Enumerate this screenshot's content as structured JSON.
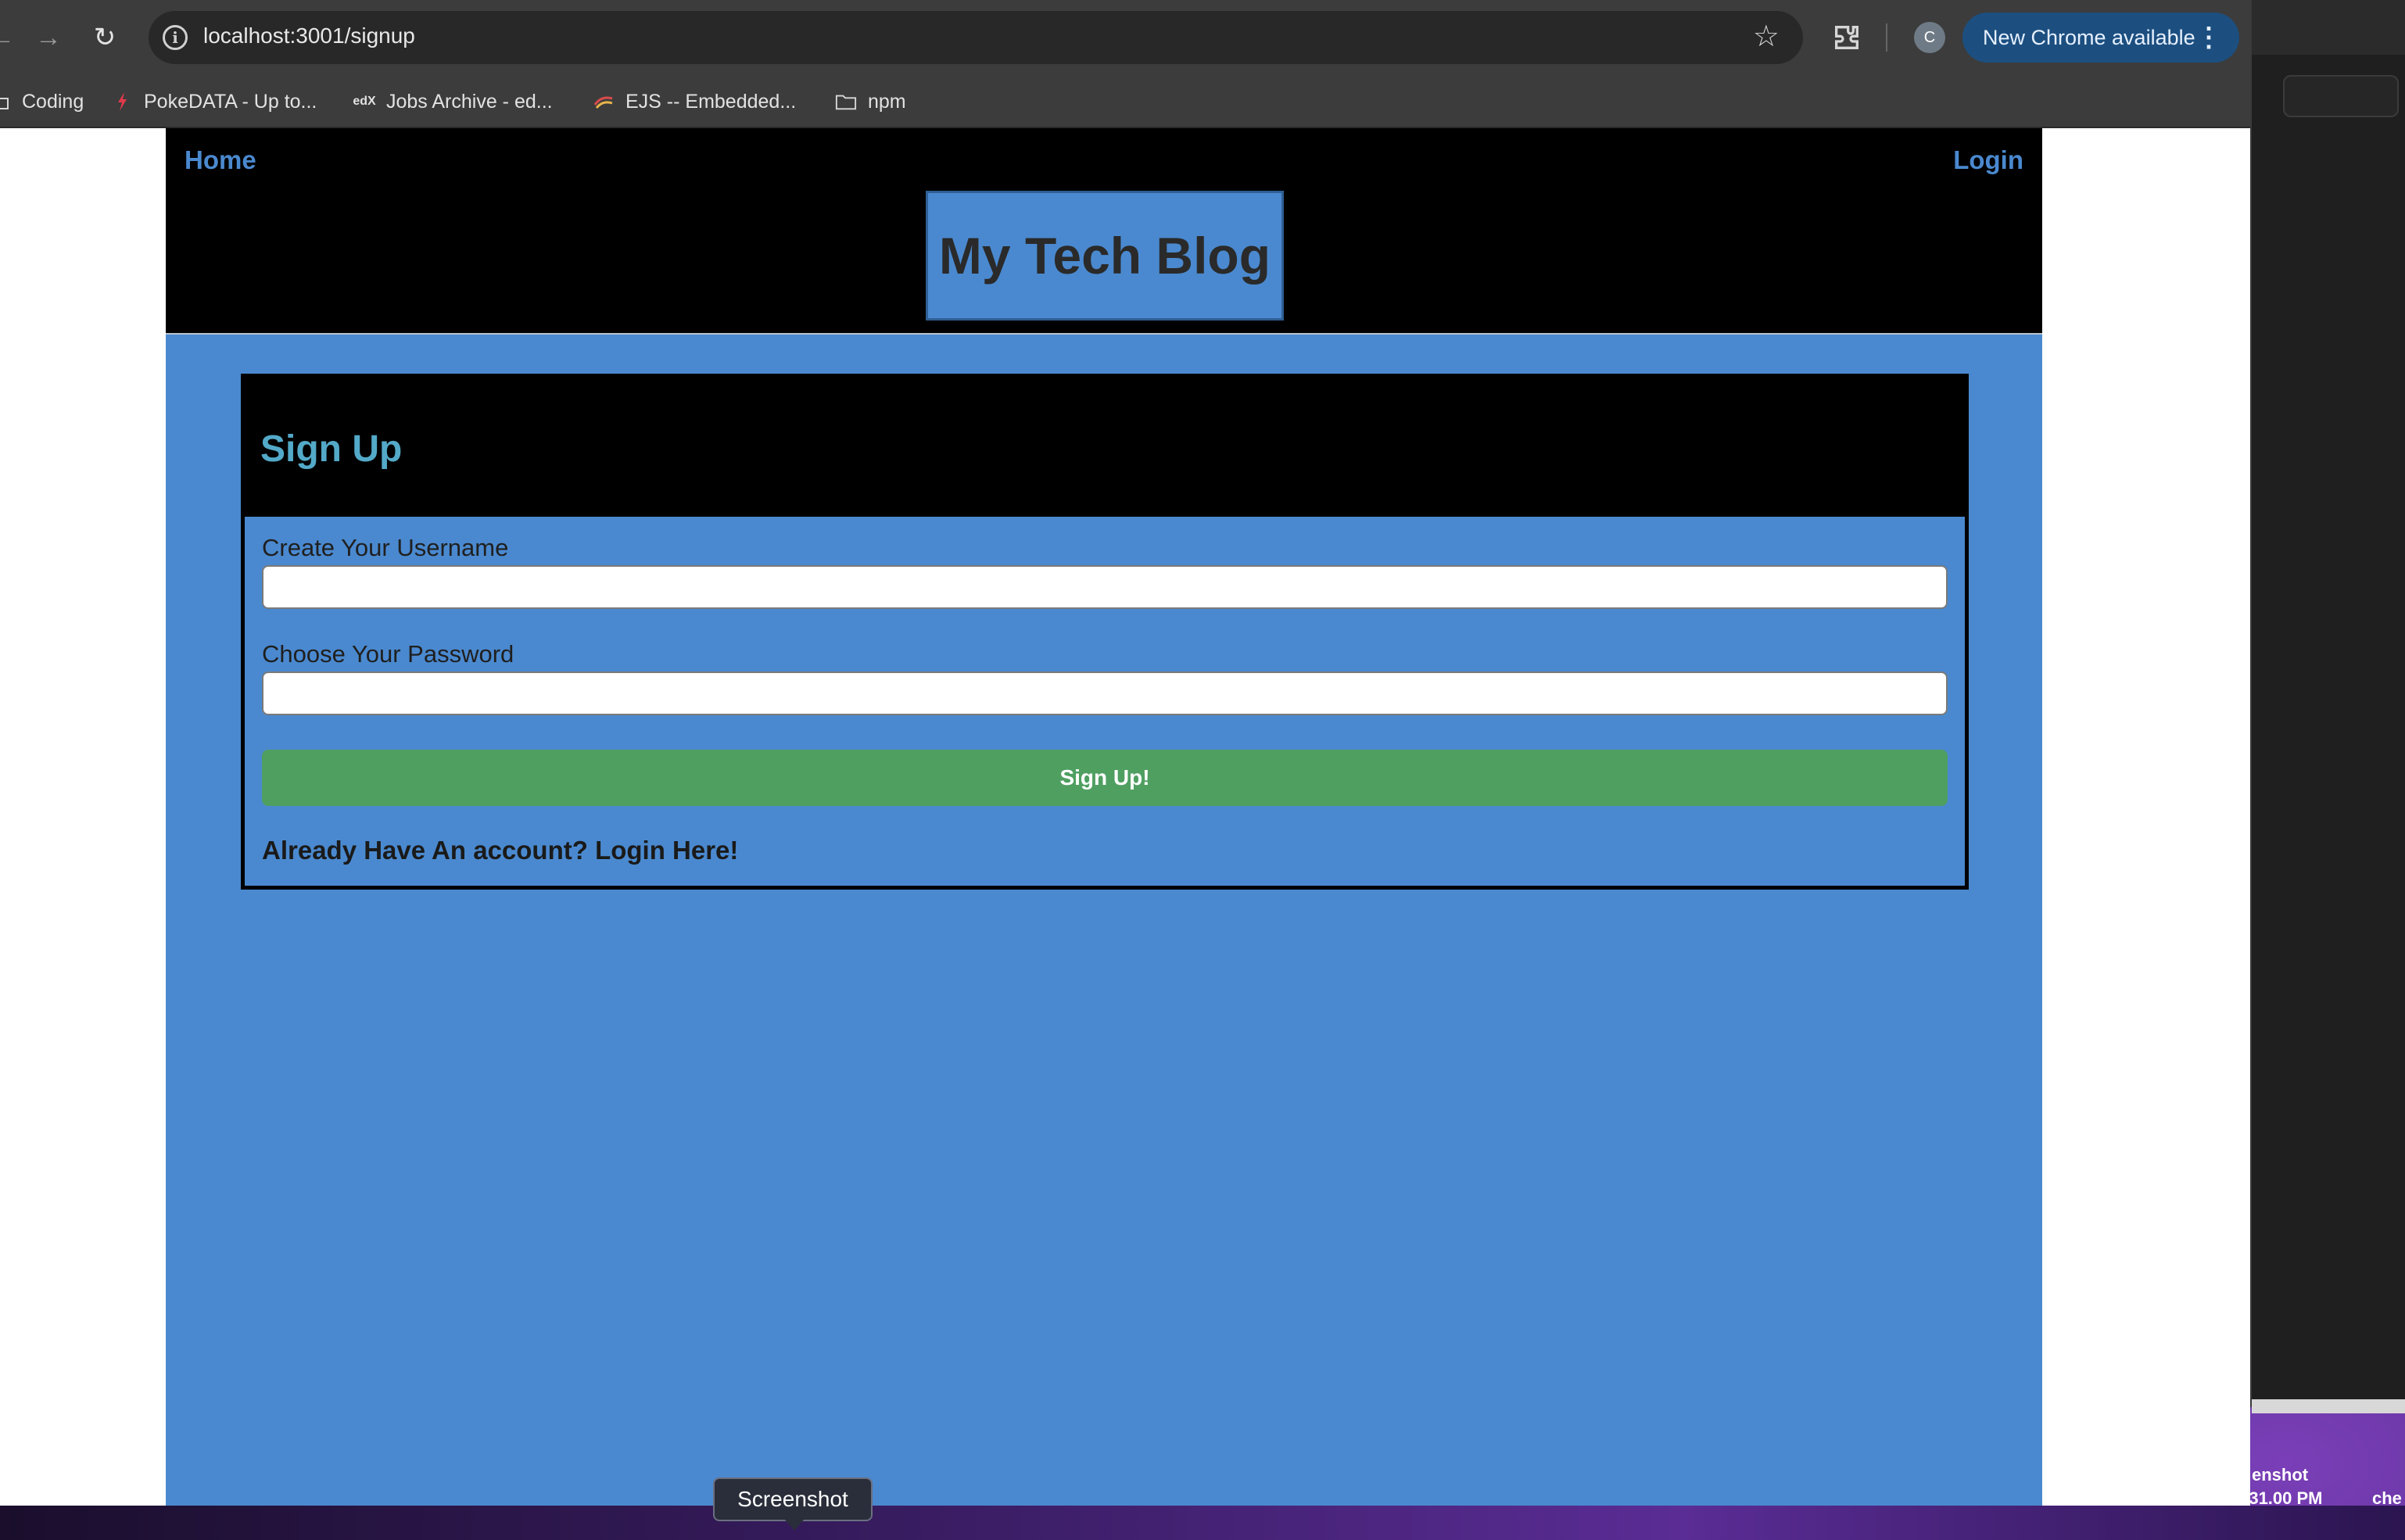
{
  "browser": {
    "url": "localhost:3001/signup",
    "update_button_label": "New Chrome available",
    "profile_initial": "C",
    "bookmarks": [
      {
        "label": "Coding",
        "icon": "folder-icon"
      },
      {
        "label": "PokeDATA - Up to...",
        "icon": "pokedata-favicon"
      },
      {
        "label": "Jobs Archive - ed...",
        "icon": "edx-favicon"
      },
      {
        "label": "EJS -- Embedded...",
        "icon": "ejs-favicon"
      },
      {
        "label": "npm",
        "icon": "folder-icon"
      }
    ]
  },
  "site": {
    "nav": {
      "home": "Home",
      "login": "Login"
    },
    "title": "My Tech Blog",
    "colors": {
      "header": "#000000",
      "accent": "#4a89cf",
      "button": "#4f9f61",
      "heading": "#53a9c8"
    }
  },
  "signup": {
    "heading": "Sign Up",
    "username_label": "Create Your Username",
    "username_value": "",
    "password_label": "Choose Your Password",
    "password_value": "",
    "submit_label": "Sign Up!",
    "login_hint": "Already Have An account? Login Here!"
  },
  "desktop": {
    "tooltip": "Screenshot",
    "partial_right_text_1": "enshot",
    "partial_right_text_2": "...31.00 PM",
    "partial_right_text_3": "che"
  }
}
